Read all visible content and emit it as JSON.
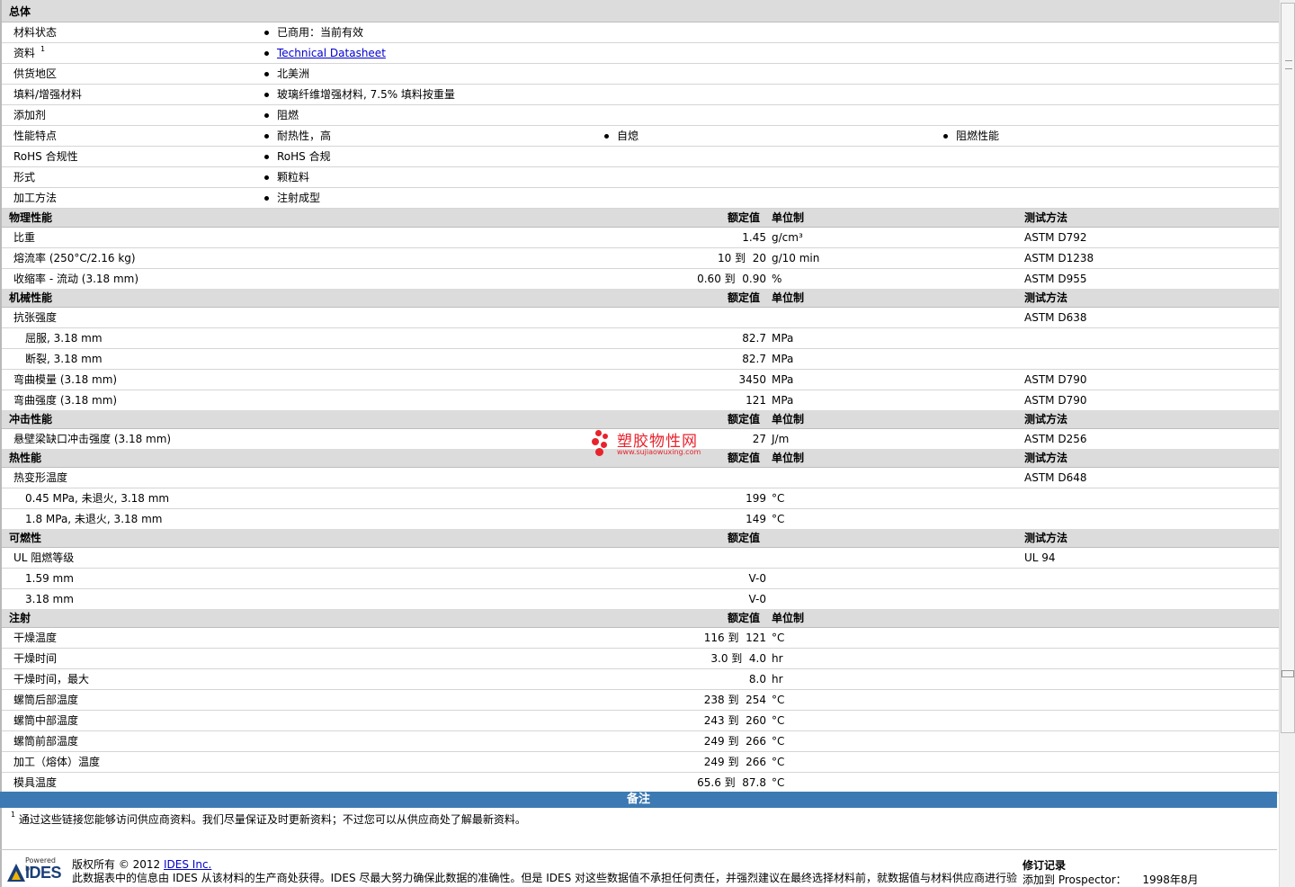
{
  "general": {
    "header": "总体",
    "rows": [
      {
        "label": "材料状态",
        "values": [
          "已商用：当前有效"
        ]
      },
      {
        "label": "资料",
        "sup": "1",
        "link": "Technical Datasheet"
      },
      {
        "label": "供货地区",
        "values": [
          "北美洲"
        ]
      },
      {
        "label": "填料/增强材料",
        "values": [
          "玻璃纤维增强材料, 7.5% 填料按重量"
        ]
      },
      {
        "label": "添加剂",
        "values": [
          "阻燃"
        ]
      },
      {
        "label": "性能特点",
        "values": [
          "耐热性，高",
          "自熄",
          "阻燃性能"
        ]
      },
      {
        "label": "RoHS 合规性",
        "values": [
          "RoHS 合规"
        ]
      },
      {
        "label": "形式",
        "values": [
          "颗粒料"
        ]
      },
      {
        "label": "加工方法",
        "values": [
          "注射成型"
        ]
      }
    ]
  },
  "columns": {
    "nominal": "额定值",
    "unit": "单位制",
    "method": "测试方法"
  },
  "physical": {
    "header": "物理性能",
    "rows": [
      {
        "label": "比重",
        "value": "1.45",
        "unit": "g/cm³",
        "method": "ASTM D792"
      },
      {
        "label": "熔流率 (250°C/2.16 kg)",
        "value": "10 到  20",
        "unit": "g/10 min",
        "method": "ASTM D1238"
      },
      {
        "label": "收缩率 - 流动 (3.18 mm)",
        "value": "0.60 到  0.90",
        "unit": "%",
        "method": "ASTM D955"
      }
    ]
  },
  "mechanical": {
    "header": "机械性能",
    "rows": [
      {
        "label": "抗张强度",
        "value": "",
        "unit": "",
        "method": "ASTM D638"
      },
      {
        "label": "屈服, 3.18 mm",
        "value": "82.7",
        "unit": "MPa",
        "method": "",
        "indent": true
      },
      {
        "label": "断裂, 3.18 mm",
        "value": "82.7",
        "unit": "MPa",
        "method": "",
        "indent": true
      },
      {
        "label": "弯曲模量 (3.18 mm)",
        "value": "3450",
        "unit": "MPa",
        "method": "ASTM D790"
      },
      {
        "label": "弯曲强度 (3.18 mm)",
        "value": "121",
        "unit": "MPa",
        "method": "ASTM D790"
      }
    ]
  },
  "impact": {
    "header": "冲击性能",
    "rows": [
      {
        "label": "悬壁梁缺口冲击强度 (3.18 mm)",
        "value": "27",
        "unit": "J/m",
        "method": "ASTM D256"
      }
    ]
  },
  "thermal": {
    "header": "热性能",
    "rows": [
      {
        "label": "热变形温度",
        "value": "",
        "unit": "",
        "method": "ASTM D648"
      },
      {
        "label": "0.45 MPa, 未退火, 3.18 mm",
        "value": "199",
        "unit": "°C",
        "method": "",
        "indent": true
      },
      {
        "label": "1.8 MPa, 未退火, 3.18 mm",
        "value": "149",
        "unit": "°C",
        "method": "",
        "indent": true
      }
    ]
  },
  "flammability": {
    "header": "可燃性",
    "rows": [
      {
        "label": "UL 阻燃等级",
        "value": "",
        "unit": "",
        "method": "UL 94"
      },
      {
        "label": "1.59 mm",
        "value": "V-0",
        "unit": "",
        "method": "",
        "indent": true
      },
      {
        "label": "3.18 mm",
        "value": "V-0",
        "unit": "",
        "method": "",
        "indent": true
      }
    ]
  },
  "injection": {
    "header": "注射",
    "rows": [
      {
        "label": "干燥温度",
        "value": "116 到  121",
        "unit": "°C"
      },
      {
        "label": "干燥时间",
        "value": "3.0 到  4.0",
        "unit": "hr"
      },
      {
        "label": "干燥时间，最大",
        "value": "8.0",
        "unit": "hr"
      },
      {
        "label": "螺筒后部温度",
        "value": "238 到  254",
        "unit": "°C"
      },
      {
        "label": "螺筒中部温度",
        "value": "243 到  260",
        "unit": "°C"
      },
      {
        "label": "螺筒前部温度",
        "value": "249 到  266",
        "unit": "°C"
      },
      {
        "label": "加工（熔体）温度",
        "value": "249 到  266",
        "unit": "°C"
      },
      {
        "label": "模具温度",
        "value": "65.6 到  87.8",
        "unit": "°C"
      }
    ]
  },
  "notes": {
    "header": "备注",
    "sup": "1",
    "text": "通过这些链接您能够访问供应商资料。我们尽量保证及时更新资料；不过您可以从供应商处了解最新资料。"
  },
  "footer": {
    "powered_by": "Powered by",
    "logo_text": "IDES",
    "copyright_prefix": "版权所有 © 2012",
    "copyright_link": "IDES Inc.",
    "disclaimer": "此数据表中的信息由 IDES 从该材料的生产商处获得。IDES 尽最大努力确保此数据的准确性。但是 IDES 对这些数据值不承担任何责任，并强烈建议在最终选择材料前，就数据值与材料供应商进行验",
    "revision_title": "修订记录",
    "revision_label": "添加到 Prospector：",
    "revision_date": "1998年8月"
  },
  "watermark": {
    "title": "塑胶物性网",
    "url": "www.sujiaowuxing.com"
  }
}
